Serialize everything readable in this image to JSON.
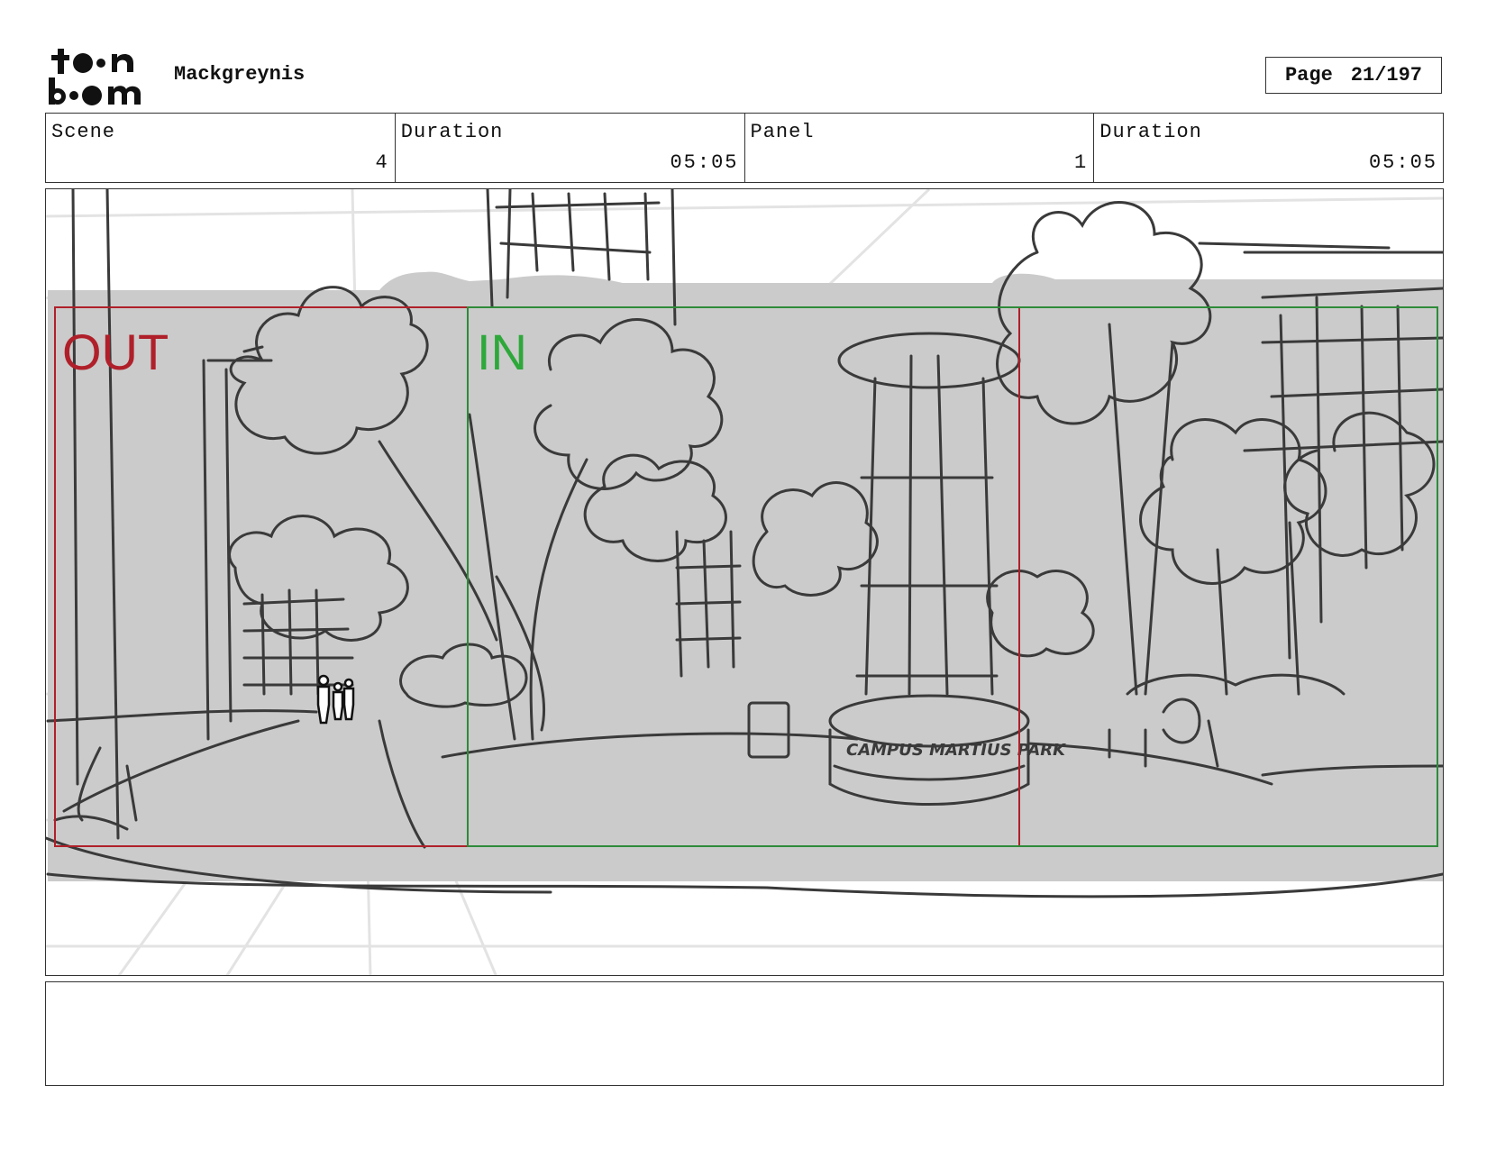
{
  "header": {
    "logo_alt": "toon boom",
    "project_title": "Mackgreynis",
    "page_label": "Page",
    "page_number": "21/197"
  },
  "info": [
    {
      "label": "Scene",
      "value": "4"
    },
    {
      "label": "Duration",
      "value": "05:05"
    },
    {
      "label": "Panel",
      "value": "1"
    },
    {
      "label": "Duration",
      "value": "05:05"
    }
  ],
  "panel": {
    "out_label": "OUT",
    "in_label": "IN",
    "sign_text": "CAMPUS MARTIUS PARK",
    "colors": {
      "out_frame": "#b0202a",
      "in_frame": "#2e8b3a",
      "shade": "#cbcbcb",
      "sketch": "#3a3a3a"
    }
  },
  "notes": {
    "text": ""
  }
}
